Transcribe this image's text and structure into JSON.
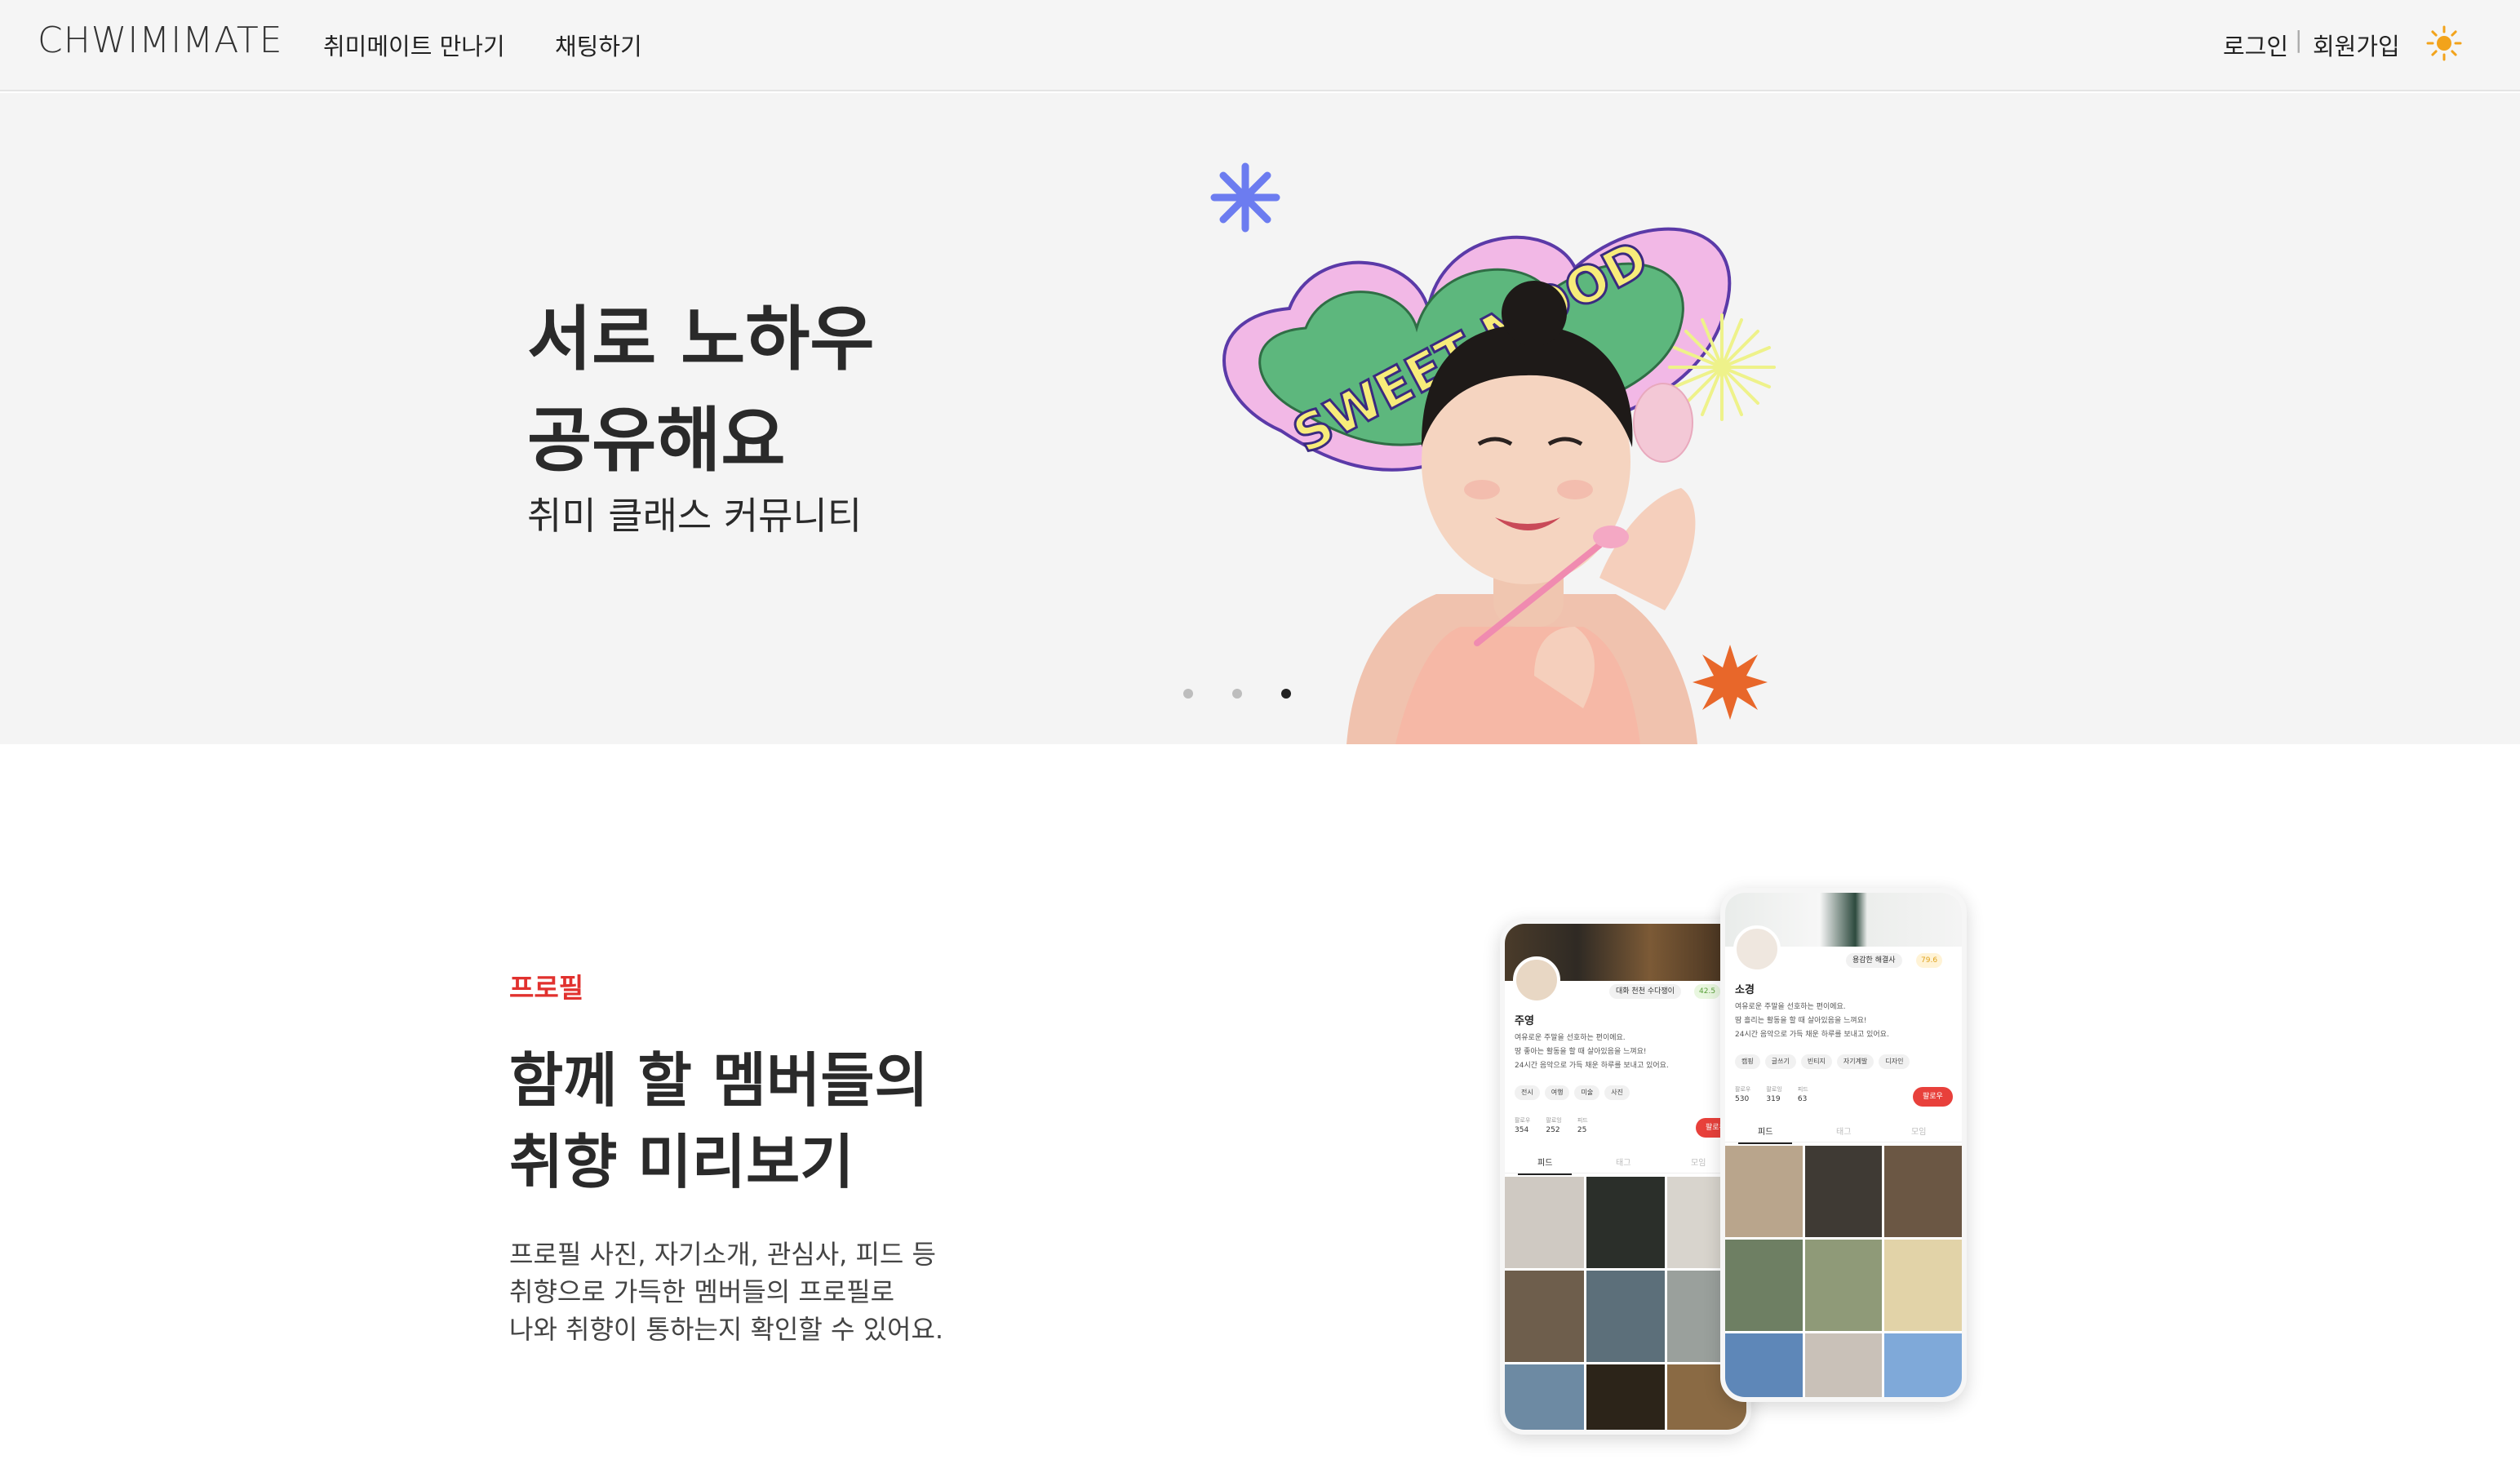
{
  "header": {
    "logo": "CHWIMIMATE",
    "nav": [
      "취미메이트 만나기",
      "채팅하기"
    ],
    "login": "로그인",
    "separator": "|",
    "signup": "회원가입",
    "theme_icon": "sun-icon"
  },
  "hero": {
    "title": "서로 노하우\n공유해요",
    "subtitle": "취미 클래스 커뮤니티",
    "sticker_text": "SWEET MOOD",
    "slides_total": 3,
    "active_slide": 3
  },
  "profile_section": {
    "tag": "프로필",
    "title": "함께 할 멤버들의\n취향 미리보기",
    "description": "프로필 사진, 자기소개, 관심사, 피드 등\n취향으로 가득한 멤버들의 프로필로\n나와 취향이 통하는지 확인할 수 있어요.",
    "phones": [
      {
        "name": "주영",
        "badge": "대화 천천 수다쟁이",
        "score": "42.5",
        "bio": "여유로운 주말을 선호하는 편이에요.\n땅 좋아는 활동을 할 때 살아있음을 느껴요!\n24시간 음악으로 가득 채운 하루를 보내고 있어요.",
        "tags": [
          "전시",
          "여행",
          "미술",
          "사진"
        ],
        "stats": [
          {
            "label": "팔로우",
            "value": "354"
          },
          {
            "label": "팔로잉",
            "value": "252"
          },
          {
            "label": "피드",
            "value": "25"
          }
        ],
        "follow": "팔로우",
        "tabs": [
          "피드",
          "태그",
          "모임"
        ]
      },
      {
        "name": "소경",
        "badge": "용감한 해결사",
        "score": "79.6",
        "bio": "여유로운 주말을 선호하는 편이에요.\n땀 흘리는 활동을 할 때 살아있음을 느껴요!\n24시간 음악으로 가득 채운 하루를 보내고 있어요.",
        "tags": [
          "캠핑",
          "글쓰기",
          "빈티지",
          "자기계발",
          "디자인"
        ],
        "stats": [
          {
            "label": "팔로우",
            "value": "530"
          },
          {
            "label": "팔로잉",
            "value": "319"
          },
          {
            "label": "피드",
            "value": "63"
          }
        ],
        "follow": "팔로우",
        "tabs": [
          "피드",
          "태그",
          "모임"
        ]
      }
    ]
  },
  "colors": {
    "accent_red": "#e1312e",
    "header_bg": "#f5f5f5",
    "hero_bg": "#f4f4f4",
    "sticker_green": "#5db77d",
    "sticker_pink": "#f2b8e6",
    "sun": "#f2a31b"
  }
}
